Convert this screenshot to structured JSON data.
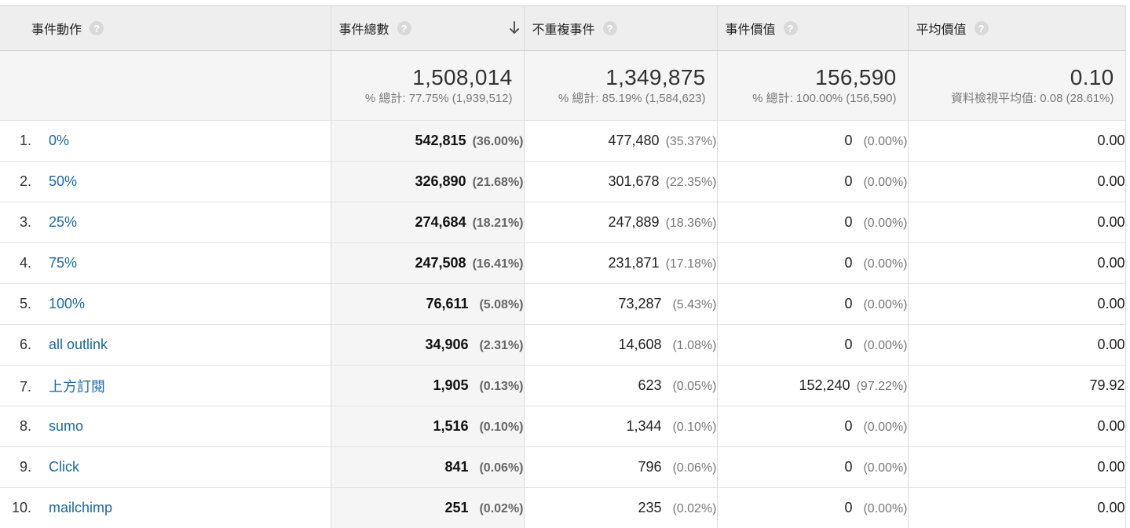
{
  "header": {
    "col1": "事件動作",
    "col2": "事件總數",
    "col3": "不重複事件",
    "col4": "事件價值",
    "col5": "平均價值",
    "help_glyph": "?"
  },
  "totals": {
    "total_events": {
      "value": "1,508,014",
      "sub": "% 總計: 77.75% (1,939,512)"
    },
    "unique_events": {
      "value": "1,349,875",
      "sub": "% 總計: 85.19% (1,584,623)"
    },
    "event_value": {
      "value": "156,590",
      "sub": "% 總計: 100.00% (156,590)"
    },
    "avg_value": {
      "value": "0.10",
      "sub": "資料檢視平均值: 0.08 (28.61%)"
    }
  },
  "rows": [
    {
      "idx": "1.",
      "label": "0%",
      "total": "542,815",
      "total_pct": "(36.00%)",
      "unique": "477,480",
      "unique_pct": "(35.37%)",
      "value": "0",
      "value_pct": "(0.00%)",
      "avg": "0.00"
    },
    {
      "idx": "2.",
      "label": "50%",
      "total": "326,890",
      "total_pct": "(21.68%)",
      "unique": "301,678",
      "unique_pct": "(22.35%)",
      "value": "0",
      "value_pct": "(0.00%)",
      "avg": "0.00"
    },
    {
      "idx": "3.",
      "label": "25%",
      "total": "274,684",
      "total_pct": "(18.21%)",
      "unique": "247,889",
      "unique_pct": "(18.36%)",
      "value": "0",
      "value_pct": "(0.00%)",
      "avg": "0.00"
    },
    {
      "idx": "4.",
      "label": "75%",
      "total": "247,508",
      "total_pct": "(16.41%)",
      "unique": "231,871",
      "unique_pct": "(17.18%)",
      "value": "0",
      "value_pct": "(0.00%)",
      "avg": "0.00"
    },
    {
      "idx": "5.",
      "label": "100%",
      "total": "76,611",
      "total_pct": "(5.08%)",
      "unique": "73,287",
      "unique_pct": "(5.43%)",
      "value": "0",
      "value_pct": "(0.00%)",
      "avg": "0.00"
    },
    {
      "idx": "6.",
      "label": "all outlink",
      "total": "34,906",
      "total_pct": "(2.31%)",
      "unique": "14,608",
      "unique_pct": "(1.08%)",
      "value": "0",
      "value_pct": "(0.00%)",
      "avg": "0.00"
    },
    {
      "idx": "7.",
      "label": "上方訂閱",
      "total": "1,905",
      "total_pct": "(0.13%)",
      "unique": "623",
      "unique_pct": "(0.05%)",
      "value": "152,240",
      "value_pct": "(97.22%)",
      "avg": "79.92"
    },
    {
      "idx": "8.",
      "label": "sumo",
      "total": "1,516",
      "total_pct": "(0.10%)",
      "unique": "1,344",
      "unique_pct": "(0.10%)",
      "value": "0",
      "value_pct": "(0.00%)",
      "avg": "0.00"
    },
    {
      "idx": "9.",
      "label": "Click",
      "total": "841",
      "total_pct": "(0.06%)",
      "unique": "796",
      "unique_pct": "(0.06%)",
      "value": "0",
      "value_pct": "(0.00%)",
      "avg": "0.00"
    },
    {
      "idx": "10.",
      "label": "mailchimp",
      "total": "251",
      "total_pct": "(0.02%)",
      "unique": "235",
      "unique_pct": "(0.02%)",
      "value": "0",
      "value_pct": "(0.00%)",
      "avg": "0.00"
    }
  ],
  "colors": {
    "link": "#1a6aa6",
    "header_bg": "#eeeeee",
    "sorted_col_bg": "#f5f5f5",
    "help_icon_bg": "#d9d9d9"
  },
  "icons": {
    "help": "question-circle-icon",
    "sort": "arrow-down-icon"
  }
}
